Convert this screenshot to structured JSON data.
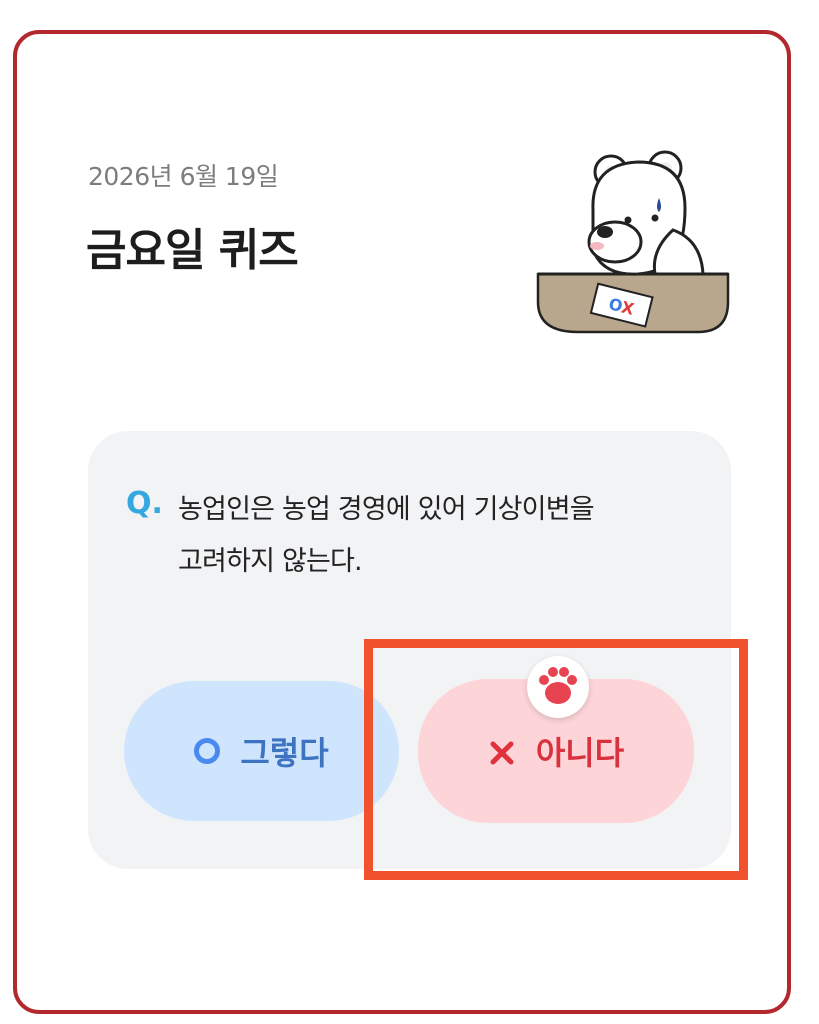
{
  "header": {
    "date": "2026년 6월 19일",
    "title": "금요일 퀴즈"
  },
  "quiz": {
    "q_label": "Q.",
    "question_line1": "농업인은 농업 경영에 있어 기상이변을",
    "question_line2": "고려하지 않는다.",
    "sheet_marks": "OX"
  },
  "answers": {
    "yes_label": "그렇다",
    "no_label": "아니다"
  },
  "icons": {
    "illustration": "polar-bear-thinking-icon",
    "yes": "circle-o-icon",
    "no": "x-icon",
    "selected_marker": "paw-icon"
  },
  "colors": {
    "card_border": "#b3282d",
    "highlight": "#f2512d",
    "yes_bg": "#cfe5fd",
    "no_bg": "#fdd4d8",
    "q_accent": "#34a8df"
  }
}
